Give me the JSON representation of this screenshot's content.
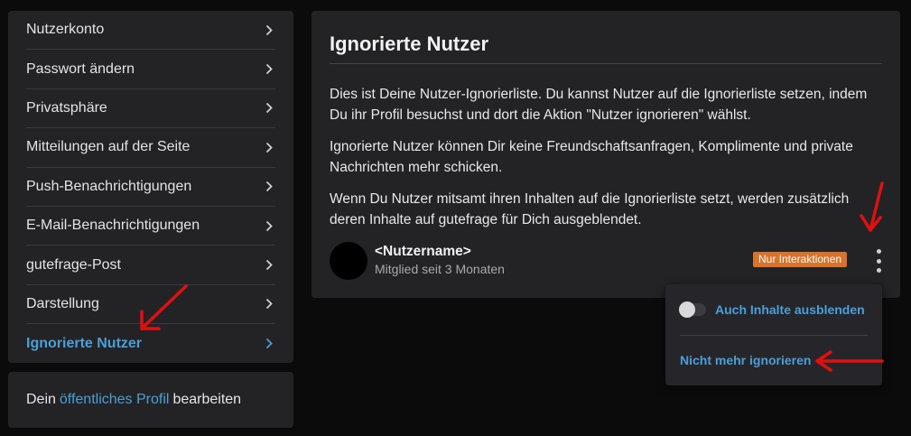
{
  "sidebar": {
    "items": [
      {
        "label": "Nutzerkonto"
      },
      {
        "label": "Passwort ändern"
      },
      {
        "label": "Privatsphäre"
      },
      {
        "label": "Mitteilungen auf der Seite"
      },
      {
        "label": "Push-Benachrichtigungen"
      },
      {
        "label": "E-Mail-Benachrichtigungen"
      },
      {
        "label": "gutefrage-Post"
      },
      {
        "label": "Darstellung"
      },
      {
        "label": "Ignorierte Nutzer"
      }
    ],
    "active_index": 8
  },
  "profile_box": {
    "prefix": "Dein",
    "link": "öffentliches Profil",
    "suffix": "bearbeiten"
  },
  "main": {
    "title": "Ignorierte Nutzer",
    "paragraphs": [
      "Dies ist Deine Nutzer-Ignorierliste. Du kannst Nutzer auf die Ignorierliste setzen, indem Du ihr Profil besuchst und dort die Aktion \"Nutzer ignorieren\" wählst.",
      "Ignorierte Nutzer können Dir keine Freundschaftsanfragen, Komplimente und private Nachrichten mehr schicken.",
      "Wenn Du Nutzer mitsamt ihren Inhalten auf die Ignorierliste setzt, werden zusätzlich deren Inhalte auf gutefrage für Dich ausgeblendet."
    ],
    "user": {
      "name": "<Nutzername>",
      "member_since": "Mitglied seit 3 Monaten",
      "badge": "Nur Interaktionen"
    }
  },
  "dropdown": {
    "toggle_label": "Auch Inhalte ausblenden",
    "toggle_on": false,
    "unignore_label": "Nicht mehr ignorieren"
  },
  "colors": {
    "accent": "#4a9fd8",
    "badge": "#d9732b",
    "annotation_arrow": "#e01010"
  }
}
